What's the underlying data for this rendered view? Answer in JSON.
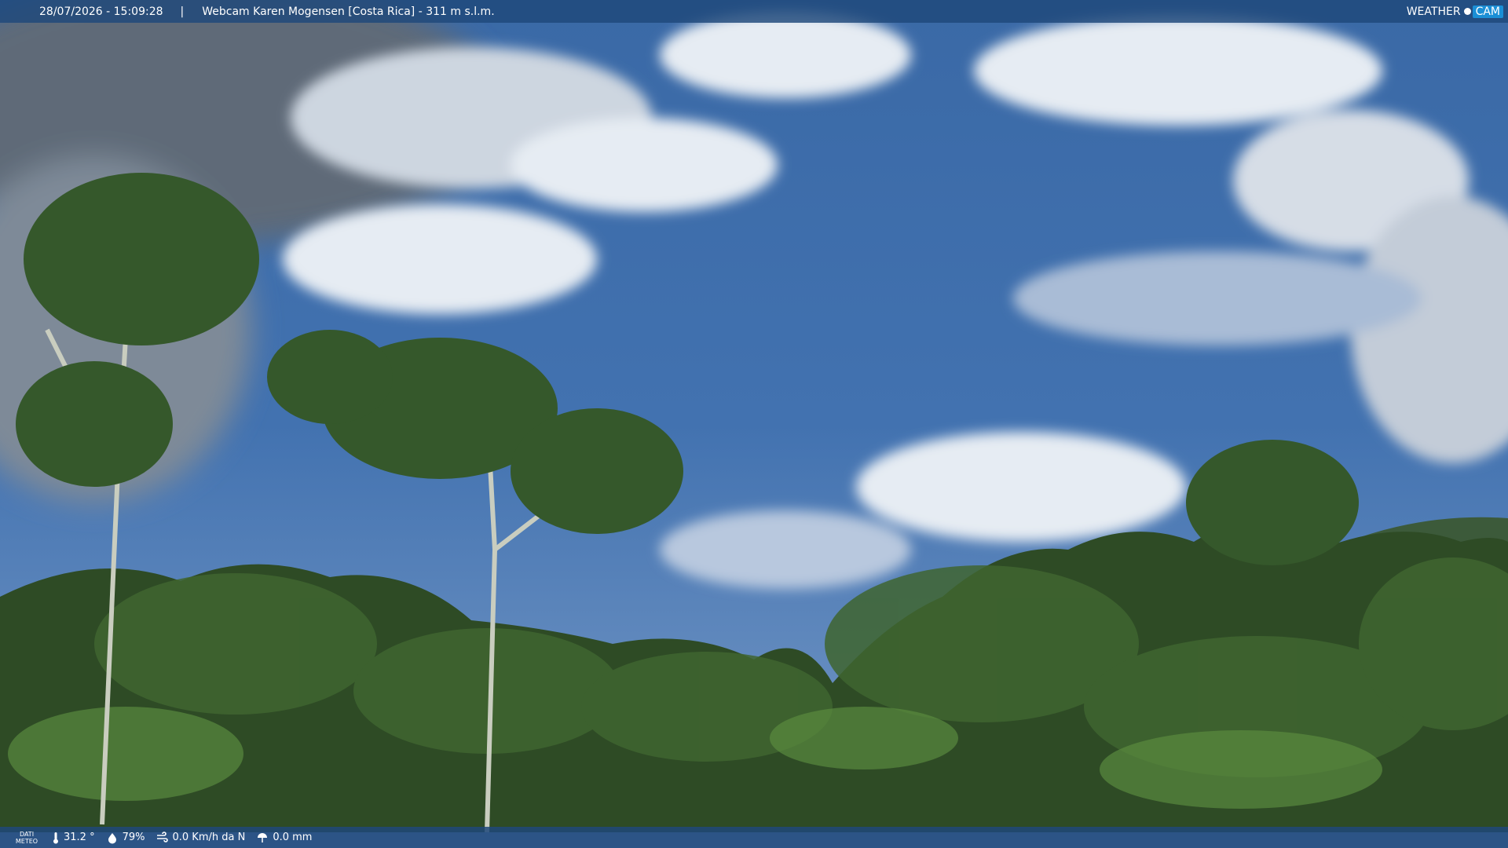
{
  "header": {
    "timestamp": "28/07/2026 - 15:09:28",
    "separator": "|",
    "title": "Webcam Karen Mogensen [Costa Rica] - 311 m s.l.m."
  },
  "logo": {
    "part1": "WEATHER",
    "part2": "CAM"
  },
  "footer": {
    "label_line1": "DATI",
    "label_line2": "METEO",
    "temperature": "31.2 °",
    "humidity": "79%",
    "wind": "0.0 Km/h da N",
    "rain": "0.0 mm"
  },
  "icons": {
    "temperature": "thermometer-icon",
    "humidity": "humidity-icon",
    "wind": "wind-icon",
    "rain": "rain-icon"
  }
}
